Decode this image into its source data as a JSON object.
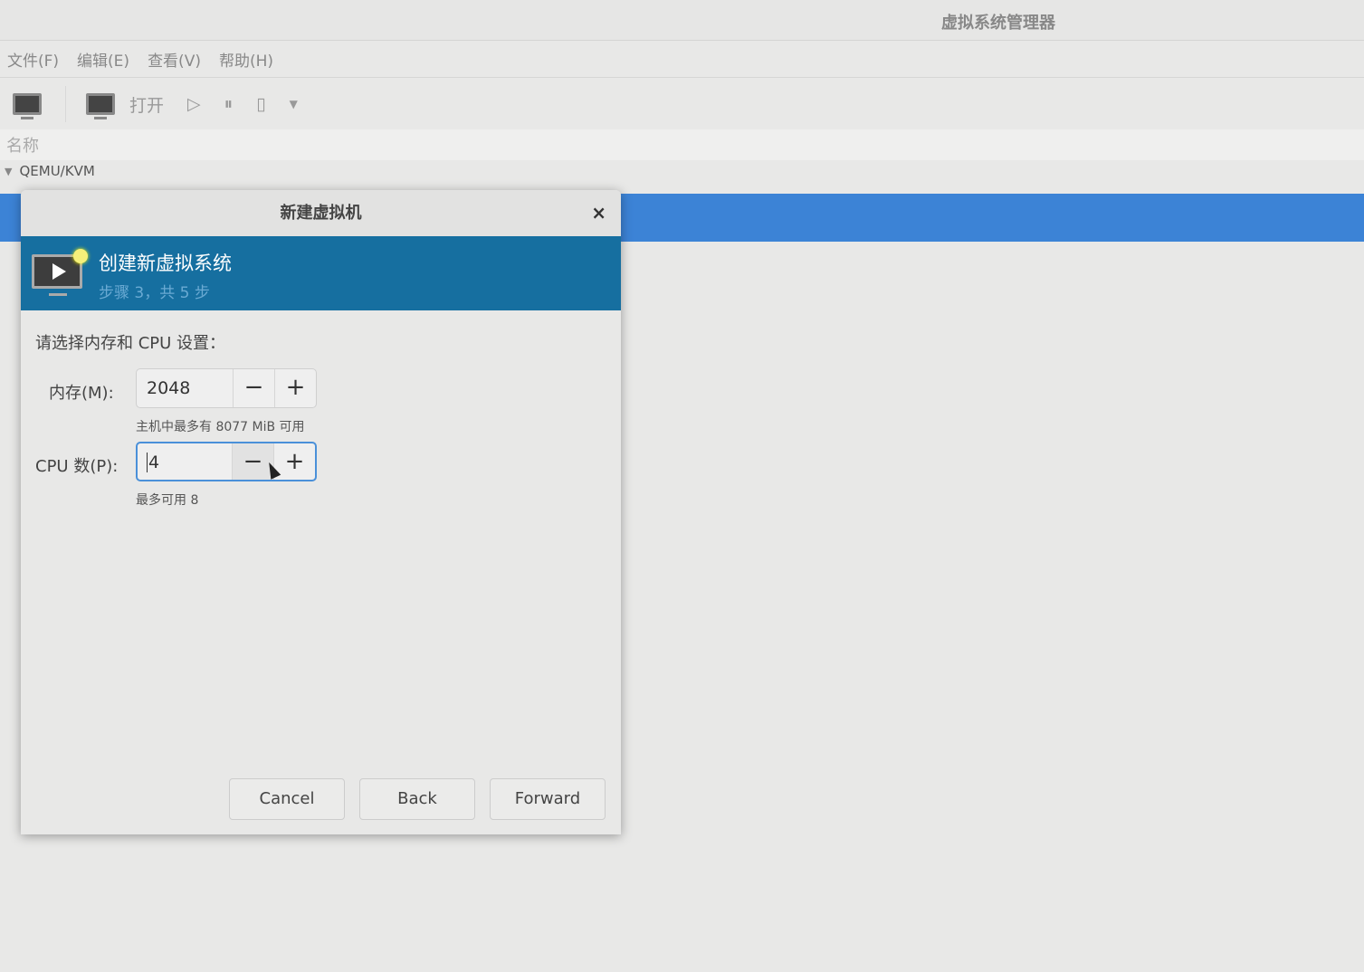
{
  "window": {
    "title": "虚拟系统管理器"
  },
  "menu": [
    "文件(F)",
    "编辑(E)",
    "查看(V)",
    "帮助(H)"
  ],
  "toolbar": {
    "open_label": "打开"
  },
  "list": {
    "column_name": "名称",
    "connection": "QEMU/KVM"
  },
  "dialog": {
    "title": "新建虚拟机",
    "close": "×",
    "banner_title": "创建新虚拟系统",
    "banner_step": "步骤 3，共 5 步",
    "prompt": "请选择内存和 CPU 设置：",
    "memory": {
      "label": "内存(M):",
      "value": "2048",
      "hint": "主机中最多有 8077 MiB 可用"
    },
    "cpu": {
      "label": "CPU 数(P):",
      "value": "4",
      "hint": "最多可用 8"
    },
    "minus": "−",
    "plus": "+",
    "buttons": {
      "cancel": "Cancel",
      "back": "Back",
      "forward": "Forward"
    }
  },
  "colors": {
    "selection": "#3c83d6",
    "banner": "#166fa0"
  }
}
